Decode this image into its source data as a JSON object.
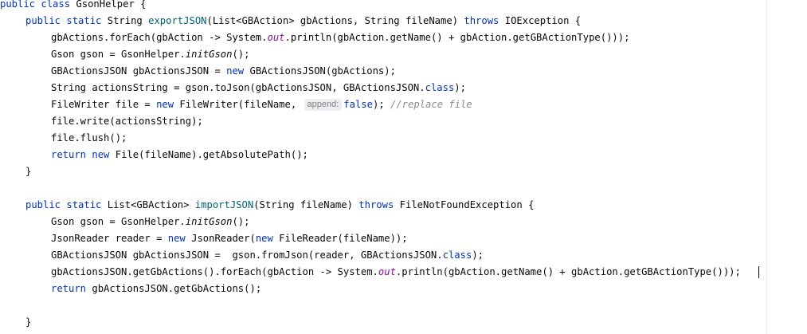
{
  "code": {
    "class_decl": {
      "public": "public",
      "class": "class",
      "name": "GsonHelper",
      "brace": " {"
    },
    "export_sig": {
      "public": "public",
      "static": "static",
      "ret": "String",
      "name": "exportJSON",
      "params_a": "(List<GBAction> gbActions, String fileName) ",
      "throws": "throws",
      "ex": " IOException {"
    },
    "e1": {
      "a": "gbActions.forEach(gbAction -> System.",
      "out": "out",
      "b": ".println(gbAction.getName() + gbAction.getGBActionType()));"
    },
    "e2": {
      "a": "Gson gson = GsonHelper.",
      "init": "initGson",
      "b": "();"
    },
    "e3": {
      "a": "GBActionsJSON gbActionsJSON = ",
      "new": "new",
      "b": " GBActionsJSON(gbActions);"
    },
    "e4": {
      "a": "String actionsString = gson.toJson(gbActionsJSON, GBActionsJSON.",
      "cls": "class",
      "b": ");"
    },
    "e5": {
      "a": "FileWriter file = ",
      "new": "new",
      "b": " FileWriter(fileName, ",
      "hint": "append:",
      "false": "false",
      "c": "); ",
      "comment": "//replace file"
    },
    "e6": {
      "a": "file.write(actionsString);"
    },
    "e7": {
      "a": "file.flush();"
    },
    "e8": {
      "ret": "return",
      "sp": " ",
      "new": "new",
      "b": " File(fileName).getAbsolutePath();"
    },
    "close_method": "}",
    "import_sig": {
      "public": "public",
      "static": "static",
      "ret": "List<GBAction>",
      "name": "importJSON",
      "params_a": "(String fileName) ",
      "throws": "throws",
      "ex": " FileNotFoundException {"
    },
    "i1": {
      "a": "Gson gson = GsonHelper.",
      "init": "initGson",
      "b": "();"
    },
    "i2": {
      "a": "JsonReader reader = ",
      "new1": "new",
      "b": " JsonReader(",
      "new2": "new",
      "c": " FileReader(fileName));"
    },
    "i3": {
      "a": "GBActionsJSON gbActionsJSON =  gson.fromJson(reader, GBActionsJSON.",
      "cls": "class",
      "b": ");"
    },
    "i4": {
      "a": "gbActionsJSON.getGbActions().forEach(gbAction -> System.",
      "out": "out",
      "b": ".println(gbAction.getName() + gbAction.getGBActionType()));"
    },
    "i5": {
      "ret": "return",
      "b": " gbActionsJSON.getGbActions();"
    },
    "close_class": "}"
  }
}
